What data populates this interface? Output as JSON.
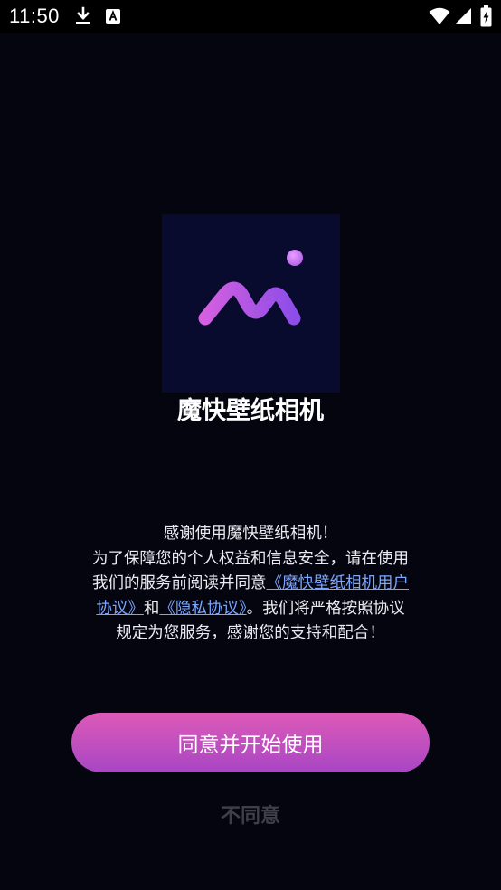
{
  "status_bar": {
    "time": "11:50",
    "icons": [
      "download-icon",
      "a-box-icon",
      "wifi-icon",
      "signal-icon",
      "battery-charging-icon"
    ]
  },
  "app": {
    "name": "魔快壁纸相机",
    "logo": "wave-logo-icon"
  },
  "notice": {
    "intro": "感谢使用魔快壁纸相机！",
    "text_before": "为了保障您的个人权益和信息安全，请在使用我们的服务前阅读并同意",
    "link_user_agreement": "《魔快壁纸相机用户协议》",
    "conjunction": "和",
    "link_privacy": "《隐私协议》",
    "text_after": "。我们将严格按照协议规定为您服务，感谢您的支持和配合！"
  },
  "actions": {
    "agree_label": "同意并开始使用",
    "decline_label": "不同意"
  },
  "colors": {
    "background": "#05050f",
    "logo_background": "#080a2e",
    "link": "#7aa6ff",
    "button_gradient_top": "#dd5ab8",
    "button_gradient_bottom": "#a846c4",
    "decline_text": "#3f3f4a"
  }
}
